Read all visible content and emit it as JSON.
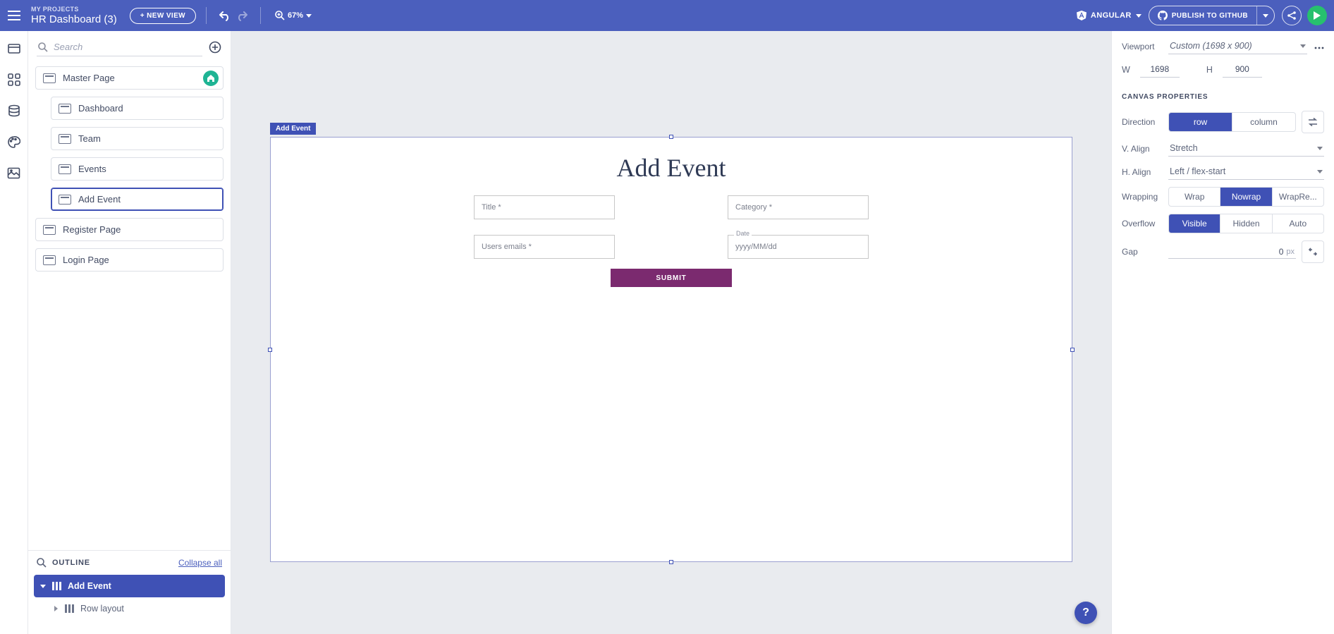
{
  "header": {
    "breadcrumb": "MY PROJECTS",
    "title": "HR Dashboard (3)",
    "new_view_label": "+ NEW VIEW",
    "zoom": "67%",
    "framework": "ANGULAR",
    "publish_label": "PUBLISH TO GITHUB"
  },
  "search": {
    "placeholder": "Search"
  },
  "views": [
    {
      "label": "Master Page",
      "is_home": true,
      "selected": false,
      "children": [
        {
          "label": "Dashboard",
          "selected": false
        },
        {
          "label": "Team",
          "selected": false
        },
        {
          "label": "Events",
          "selected": false
        },
        {
          "label": "Add Event",
          "selected": true
        }
      ]
    },
    {
      "label": "Register Page",
      "is_home": false,
      "selected": false,
      "children": []
    },
    {
      "label": "Login Page",
      "is_home": false,
      "selected": false,
      "children": []
    }
  ],
  "outline": {
    "header": "OUTLINE",
    "collapse_label": "Collapse all",
    "tree": [
      {
        "label": "Add Event",
        "root": true,
        "expanded": true
      },
      {
        "label": "Row layout",
        "root": false
      }
    ]
  },
  "canvas": {
    "selected_tag": "Add Event",
    "form": {
      "title": "Add Event",
      "fields": {
        "title_label": "Title *",
        "category_label": "Category *",
        "emails_label": "Users emails *",
        "date_floating": "Date",
        "date_placeholder": "yyyy/MM/dd"
      },
      "submit_label": "SUBMIT"
    }
  },
  "props": {
    "viewport_label": "Viewport",
    "viewport_value": "Custom (1698 x 900)",
    "w_label": "W",
    "w_value": "1698",
    "h_label": "H",
    "h_value": "900",
    "section_title": "CANVAS PROPERTIES",
    "direction_label": "Direction",
    "direction_options": {
      "row": "row",
      "column": "column"
    },
    "direction_active": "row",
    "valign_label": "V. Align",
    "valign_value": "Stretch",
    "halign_label": "H. Align",
    "halign_value": "Left / flex-start",
    "wrapping_label": "Wrapping",
    "wrapping_options": {
      "wrap": "Wrap",
      "nowrap": "Nowrap",
      "wraprev": "WrapRe..."
    },
    "wrapping_active": "nowrap",
    "overflow_label": "Overflow",
    "overflow_options": {
      "visible": "Visible",
      "hidden": "Hidden",
      "auto": "Auto"
    },
    "overflow_active": "visible",
    "gap_label": "Gap",
    "gap_value": "0",
    "gap_unit": "px"
  },
  "help": "?"
}
